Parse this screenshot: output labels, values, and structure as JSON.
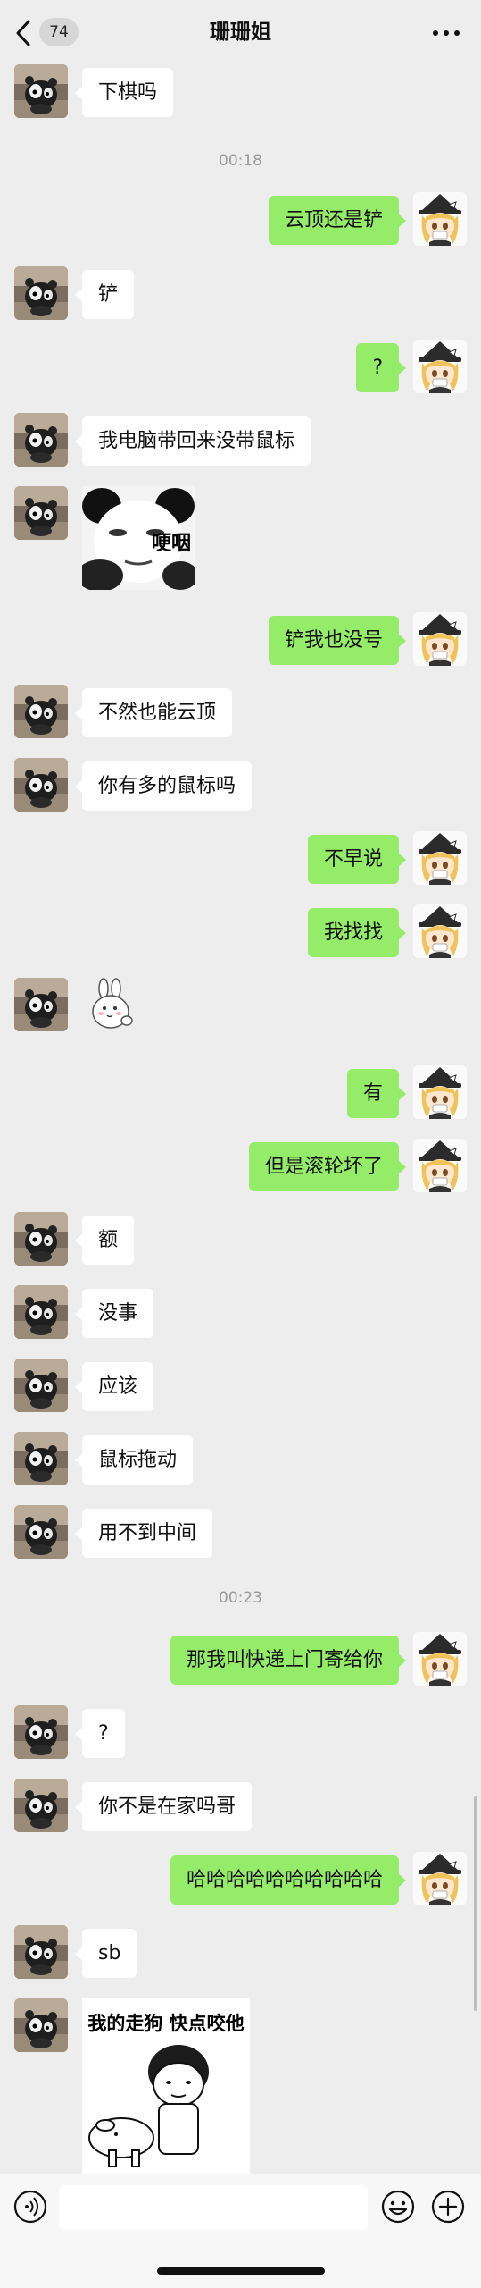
{
  "header": {
    "unread_count": "74",
    "title": "珊珊姐"
  },
  "timestamps": [
    "00:18",
    "00:23"
  ],
  "messages": [
    {
      "side": "left",
      "text": "下棋吗"
    },
    {
      "side": "right",
      "text": "云顶还是铲"
    },
    {
      "side": "left",
      "text": "铲"
    },
    {
      "side": "right",
      "text": "?"
    },
    {
      "side": "left",
      "text": "我电脑带回来没带鼠标"
    },
    {
      "side": "right",
      "text": "铲我也没号"
    },
    {
      "side": "left",
      "text": "不然也能云顶"
    },
    {
      "side": "left",
      "text": "你有多的鼠标吗"
    },
    {
      "side": "right",
      "text": "不早说"
    },
    {
      "side": "right",
      "text": "我找找"
    },
    {
      "side": "right",
      "text": "有"
    },
    {
      "side": "right",
      "text": "但是滚轮坏了"
    },
    {
      "side": "left",
      "text": "额"
    },
    {
      "side": "left",
      "text": "没事"
    },
    {
      "side": "left",
      "text": "应该"
    },
    {
      "side": "left",
      "text": "鼠标拖动"
    },
    {
      "side": "left",
      "text": "用不到中间"
    },
    {
      "side": "right",
      "text": "那我叫快递上门寄给你"
    },
    {
      "side": "left",
      "text": "?"
    },
    {
      "side": "left",
      "text": "你不是在家吗哥"
    },
    {
      "side": "right",
      "text": "哈哈哈哈哈哈哈哈哈哈"
    },
    {
      "side": "left",
      "text": "sb"
    }
  ],
  "stickers": {
    "panda_caption": "哽咽",
    "dog_caption": "我的走狗 快点咬他"
  },
  "input": {
    "placeholder": ""
  },
  "colors": {
    "background": "#ededed",
    "outgoing_bubble": "#95ec69",
    "incoming_bubble": "#ffffff"
  }
}
